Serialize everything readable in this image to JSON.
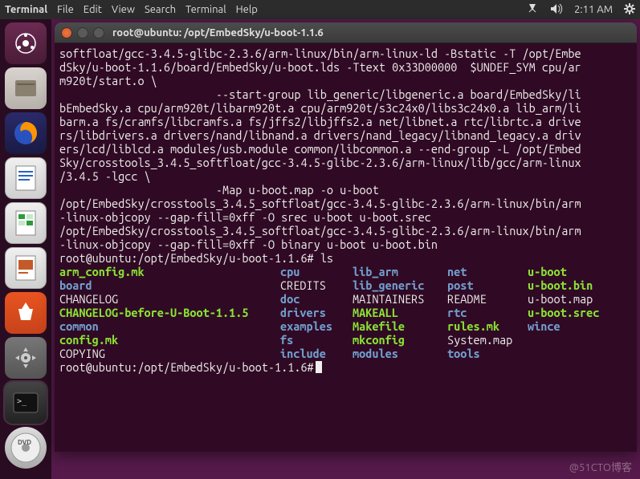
{
  "top_panel": {
    "app_name": "Terminal",
    "menus": [
      "File",
      "Edit",
      "View",
      "Search",
      "Terminal",
      "Help"
    ],
    "clock": "2:11 AM"
  },
  "launcher": [
    {
      "name": "Dash",
      "icon": "dash"
    },
    {
      "name": "Files",
      "icon": "files"
    },
    {
      "name": "Firefox",
      "icon": "firefox"
    },
    {
      "name": "LibreOffice Writer",
      "icon": "writer"
    },
    {
      "name": "LibreOffice Calc",
      "icon": "calc"
    },
    {
      "name": "LibreOffice Impress",
      "icon": "impress"
    },
    {
      "name": "Ubuntu Software",
      "icon": "software"
    },
    {
      "name": "System Settings",
      "icon": "settings"
    },
    {
      "name": "Terminal",
      "icon": "terminal"
    },
    {
      "name": "DVD",
      "icon": "dvd"
    }
  ],
  "window": {
    "title": "root@ubuntu: /opt/EmbedSky/u-boot-1.1.6"
  },
  "terminal": {
    "scrollback": "softfloat/gcc-3.4.5-glibc-2.3.6/arm-linux/bin/arm-linux-ld -Bstatic -T /opt/Embe\ndSky/u-boot-1.1.6/board/EmbedSky/u-boot.lds -Ttext 0x33D00000  $UNDEF_SYM cpu/ar\nm920t/start.o \\\n                        --start-group lib_generic/libgeneric.a board/EmbedSky/li\nbEmbedSky.a cpu/arm920t/libarm920t.a cpu/arm920t/s3c24x0/libs3c24x0.a lib_arm/li\nbarm.a fs/cramfs/libcramfs.a fs/jffs2/libjffs2.a net/libnet.a rtc/librtc.a drive\nrs/libdrivers.a drivers/nand/libnand.a drivers/nand_legacy/libnand_legacy.a driv\ners/lcd/liblcd.a modules/usb.module common/libcommon.a --end-group -L /opt/Embed\nSky/crosstools_3.4.5_softfloat/gcc-3.4.5-glibc-2.3.6/arm-linux/lib/gcc/arm-linux\n/3.4.5 -lgcc \\\n                        -Map u-boot.map -o u-boot\n/opt/EmbedSky/crosstools_3.4.5_softfloat/gcc-3.4.5-glibc-2.3.6/arm-linux/bin/arm\n-linux-objcopy --gap-fill=0xff -O srec u-boot u-boot.srec\n/opt/EmbedSky/crosstools_3.4.5_softfloat/gcc-3.4.5-glibc-2.3.6/arm-linux/bin/arm\n-linux-objcopy --gap-fill=0xff -O binary u-boot u-boot.bin",
    "prompt1": "root@ubuntu:/opt/EmbedSky/u-boot-1.1.6#",
    "cmd1": "ls",
    "ls": {
      "col1": [
        {
          "t": "arm_config.mk",
          "c": "exe"
        },
        {
          "t": "board",
          "c": "dir"
        },
        {
          "t": "CHANGELOG",
          "c": "plain"
        },
        {
          "t": "CHANGELOG-before-U-Boot-1.1.5",
          "c": "exe"
        },
        {
          "t": "common",
          "c": "dir"
        },
        {
          "t": "config.mk",
          "c": "exe"
        },
        {
          "t": "COPYING",
          "c": "plain"
        }
      ],
      "col2": [
        {
          "t": "cpu",
          "c": "dir"
        },
        {
          "t": "CREDITS",
          "c": "plain"
        },
        {
          "t": "doc",
          "c": "dir"
        },
        {
          "t": "drivers",
          "c": "dir"
        },
        {
          "t": "examples",
          "c": "dir"
        },
        {
          "t": "fs",
          "c": "dir"
        },
        {
          "t": "include",
          "c": "dir"
        }
      ],
      "col3": [
        {
          "t": "lib_arm",
          "c": "dir"
        },
        {
          "t": "lib_generic",
          "c": "dir"
        },
        {
          "t": "MAINTAINERS",
          "c": "plain"
        },
        {
          "t": "MAKEALL",
          "c": "exe"
        },
        {
          "t": "Makefile",
          "c": "exe"
        },
        {
          "t": "mkconfig",
          "c": "exe"
        },
        {
          "t": "modules",
          "c": "dir"
        }
      ],
      "col4": [
        {
          "t": "net",
          "c": "dir"
        },
        {
          "t": "post",
          "c": "dir"
        },
        {
          "t": "README",
          "c": "plain"
        },
        {
          "t": "rtc",
          "c": "dir"
        },
        {
          "t": "rules.mk",
          "c": "exe"
        },
        {
          "t": "System.map",
          "c": "plain"
        },
        {
          "t": "tools",
          "c": "dir"
        }
      ],
      "col5": [
        {
          "t": "u-boot",
          "c": "exe"
        },
        {
          "t": "u-boot.bin",
          "c": "exe"
        },
        {
          "t": "u-boot.map",
          "c": "plain"
        },
        {
          "t": "u-boot.srec",
          "c": "exe"
        },
        {
          "t": "wince",
          "c": "dir"
        }
      ]
    },
    "prompt2": "root@ubuntu:/opt/EmbedSky/u-boot-1.1.6#"
  },
  "watermark": "@51CTO博客"
}
